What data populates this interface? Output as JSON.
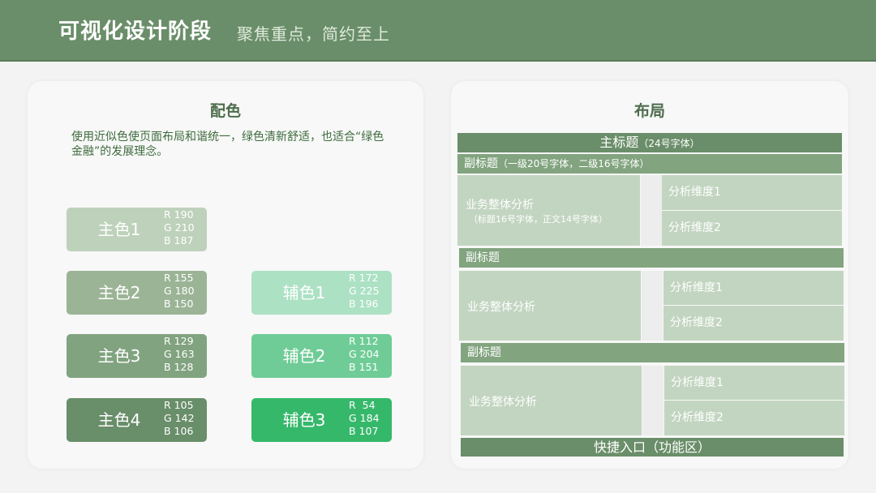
{
  "header": {
    "title": "可视化设计阶段",
    "subtitle": "聚焦重点，简约至上"
  },
  "colors_panel": {
    "title": "配色",
    "description": "使用近似色使页面布局和谐统一，绿色清新舒适，也适合“绿色金融”的发展理念。",
    "primary": [
      {
        "name": "主色1",
        "r": "R 190",
        "g": "G 210",
        "b": "B 187",
        "hex": "#bed2bb"
      },
      {
        "name": "主色2",
        "r": "R 155",
        "g": "G 180",
        "b": "B 150",
        "hex": "#9bb496"
      },
      {
        "name": "主色3",
        "r": "R 129",
        "g": "G 163",
        "b": "B 128",
        "hex": "#81a380"
      },
      {
        "name": "主色4",
        "r": "R 105",
        "g": "G 142",
        "b": "B 106",
        "hex": "#698e6a"
      }
    ],
    "secondary": [
      {
        "name": "辅色1",
        "r": "R 172",
        "g": "G 225",
        "b": "B 196",
        "hex": "#ace1c4"
      },
      {
        "name": "辅色2",
        "r": "R 112",
        "g": "G 204",
        "b": "B 151",
        "hex": "#70cc97"
      },
      {
        "name": "辅色3",
        "r": "R  54",
        "g": "G 184",
        "b": "B 107",
        "hex": "#36b86b"
      }
    ]
  },
  "layout_panel": {
    "title": "布局",
    "main_title": "主标题",
    "main_title_note": "（24号字体）",
    "sections": [
      {
        "subtitle": "副标题",
        "subtitle_note": "（一级20号字体，二级16号字体）",
        "box_title": "业务整体分析",
        "box_note": "（标题16号字体，正文14号字体）",
        "dim1": "分析维度1",
        "dim2": "分析维度2"
      },
      {
        "subtitle": "副标题",
        "box_title": "业务整体分析",
        "dim1": "分析维度1",
        "dim2": "分析维度2"
      },
      {
        "subtitle": "副标题",
        "box_title": "业务整体分析",
        "dim1": "分析维度1",
        "dim2": "分析维度2"
      }
    ],
    "footer": "快捷入口（功能区）"
  }
}
